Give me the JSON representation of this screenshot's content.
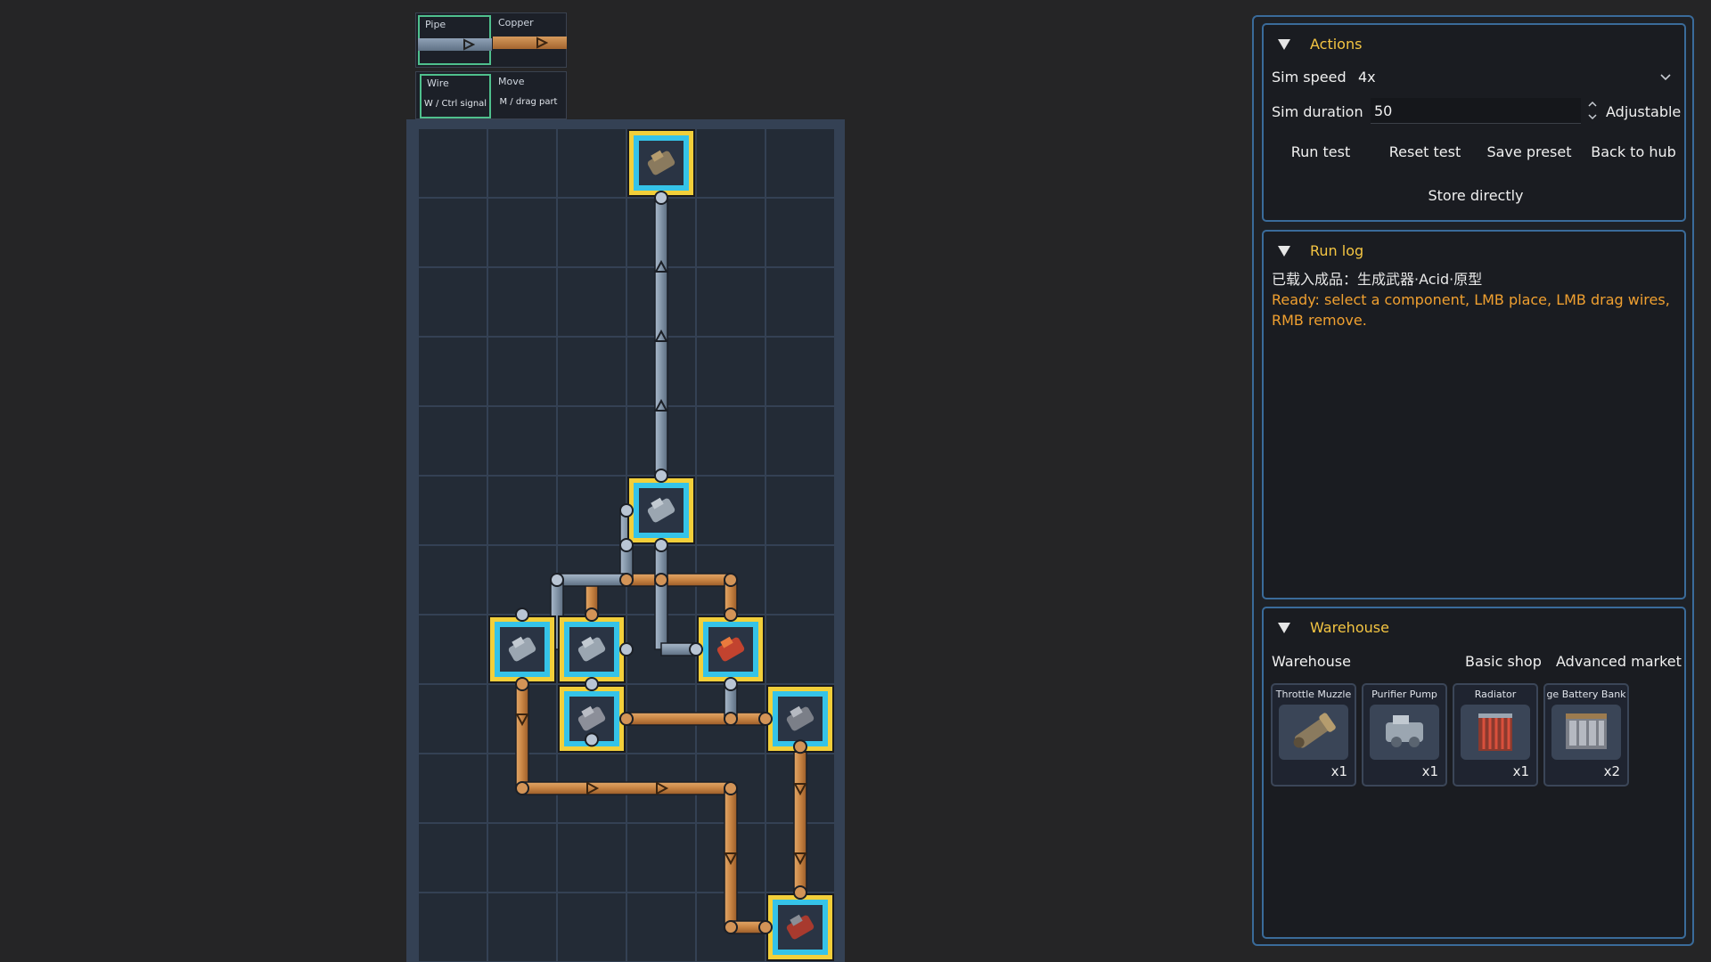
{
  "tools": {
    "pipe": {
      "label": "Pipe"
    },
    "copper": {
      "label": "Copper"
    },
    "wire": {
      "label": "Wire",
      "hint": "W / Ctrl signal"
    },
    "move": {
      "label": "Move",
      "hint": "M / drag part"
    }
  },
  "board": {
    "columns": 6,
    "rows": 12,
    "components": [
      {
        "col": 3,
        "row": 0,
        "kind": "muzzle"
      },
      {
        "col": 3,
        "row": 5,
        "kind": "pump"
      },
      {
        "col": 1,
        "row": 7,
        "kind": "pump"
      },
      {
        "col": 2,
        "row": 7,
        "kind": "pump"
      },
      {
        "col": 4,
        "row": 7,
        "kind": "radiator"
      },
      {
        "col": 2,
        "row": 8,
        "kind": "purifier"
      },
      {
        "col": 5,
        "row": 8,
        "kind": "battery"
      },
      {
        "col": 5,
        "row": 11,
        "kind": "battery-red"
      }
    ]
  },
  "actions": {
    "title": "Actions",
    "sim_speed_label": "Sim speed",
    "sim_speed_value": "4x",
    "sim_duration_label": "Sim duration",
    "sim_duration_value": "50",
    "adjustable_label": "Adjustable",
    "buttons": [
      "Run test",
      "Reset test",
      "Save preset",
      "Back to hub"
    ],
    "store_label": "Store directly"
  },
  "run_log": {
    "title": "Run log",
    "line1": "已载入成品：生成武器·Acid·原型",
    "line2": "Ready: select a component, LMB place, LMB drag wires,",
    "line3": "RMB remove."
  },
  "warehouse": {
    "title": "Warehouse",
    "tabs": [
      "Warehouse",
      "Basic shop",
      "Advanced market"
    ],
    "items": [
      {
        "name": "Throttle Muzzle",
        "qty": "x1"
      },
      {
        "name": "Purifier Pump",
        "qty": "x1"
      },
      {
        "name": "Radiator",
        "qty": "x1"
      },
      {
        "name": "ge Battery Bank",
        "qty": "x2"
      }
    ]
  },
  "colors": {
    "accent": "#f4c542",
    "log_warning": "#f0a030",
    "panel_border": "#3a6b9a",
    "copper": "#c88443",
    "pipe": "#8395a8",
    "component_frame": "#f2cf3a",
    "component_inner": "#35c3e8"
  }
}
